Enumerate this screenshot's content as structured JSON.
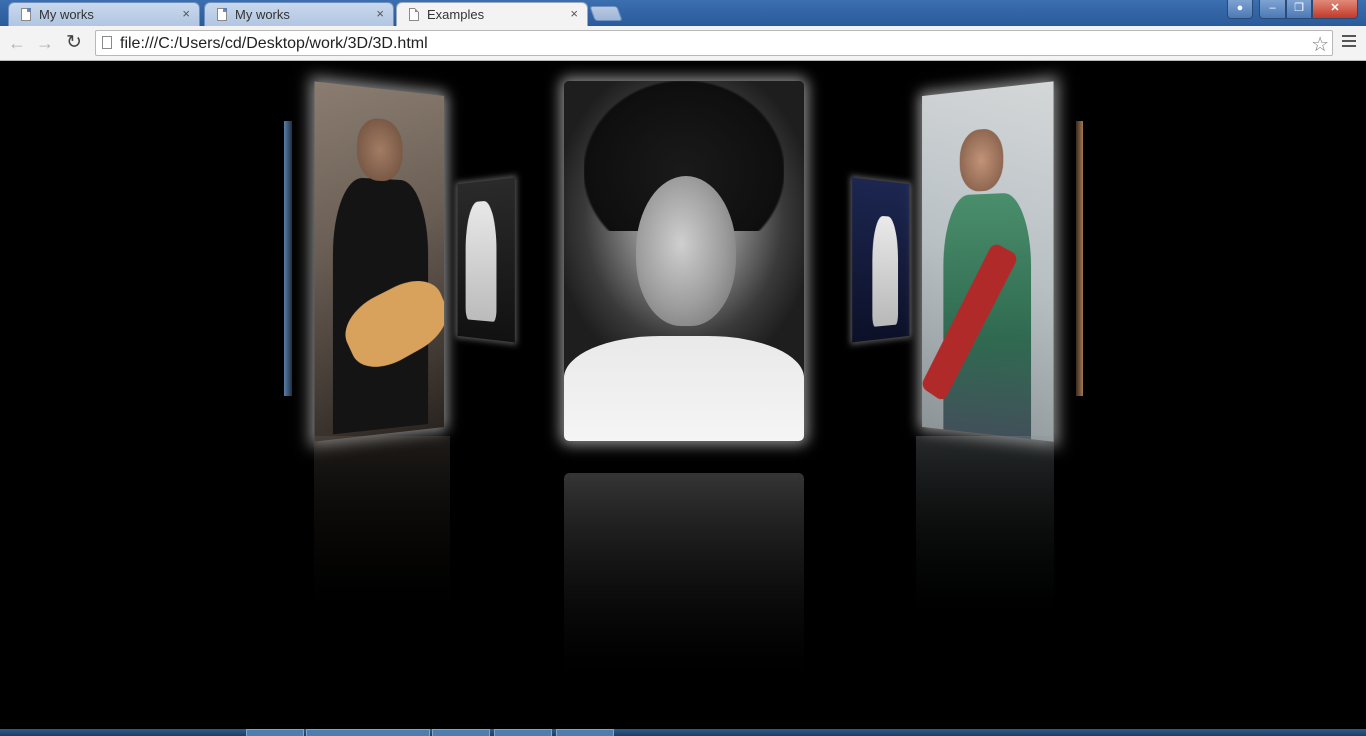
{
  "browser": {
    "tabs": [
      {
        "label": "My works",
        "active": false
      },
      {
        "label": "My works",
        "active": false
      },
      {
        "label": "Examples",
        "active": true
      }
    ],
    "close_glyph": "×",
    "window_controls": {
      "minimize": "–",
      "maximize": "❐",
      "close": "✕"
    },
    "nav": {
      "back": "←",
      "forward": "→",
      "reload": "↻"
    },
    "address": "file:///C:/Users/cd/Desktop/work/3D/3D.html",
    "bookmark_star": "☆"
  },
  "gallery": {
    "background": "#000000",
    "photos": [
      {
        "id": "left-edge",
        "icon": "photo"
      },
      {
        "id": "left-main",
        "icon": "photo"
      },
      {
        "id": "left-small",
        "icon": "photo"
      },
      {
        "id": "center",
        "icon": "photo",
        "focused": true
      },
      {
        "id": "right-small",
        "icon": "photo"
      },
      {
        "id": "right-main",
        "icon": "photo"
      },
      {
        "id": "right-edge",
        "icon": "photo"
      }
    ]
  },
  "colors": {
    "titlebar": "#2a5a9a",
    "toolbar": "#f3f3f3",
    "close_button": "#c2392a"
  }
}
